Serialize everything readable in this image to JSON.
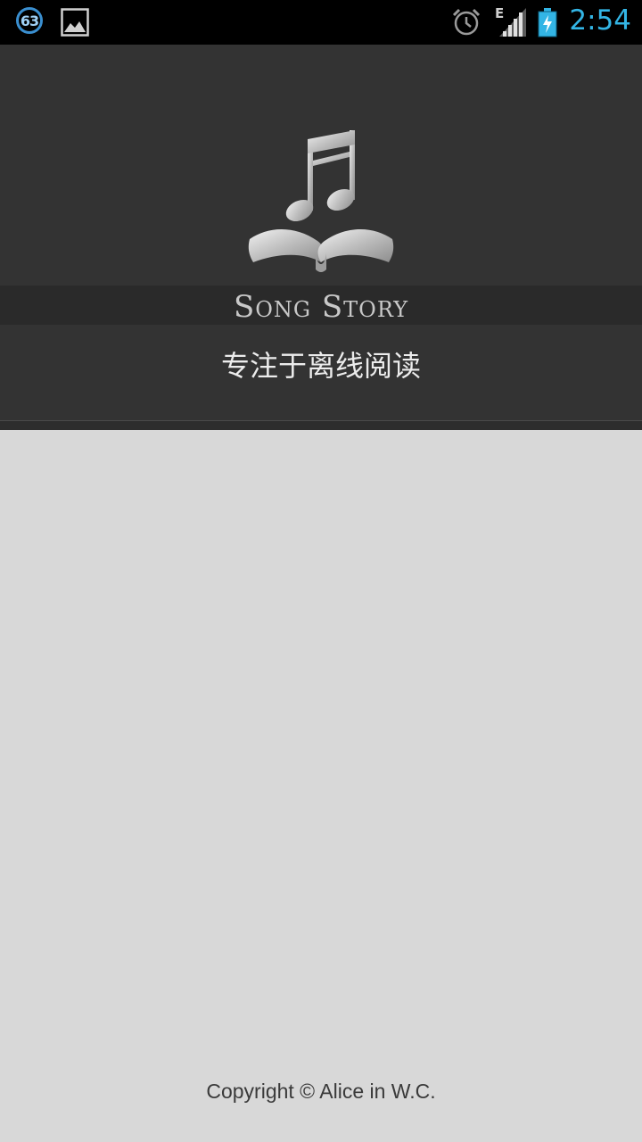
{
  "status_bar": {
    "notification_count": "63",
    "network_type": "E",
    "time": "2:54",
    "icons": [
      "notification-count-icon",
      "image-icon",
      "alarm-icon",
      "signal-icon",
      "battery-charging-icon"
    ]
  },
  "header": {
    "logo_icon": "music-note-book-icon",
    "brand": "Song Story",
    "tagline": "专注于离线阅读"
  },
  "footer": {
    "copyright": "Copyright © Alice in W.C."
  }
}
